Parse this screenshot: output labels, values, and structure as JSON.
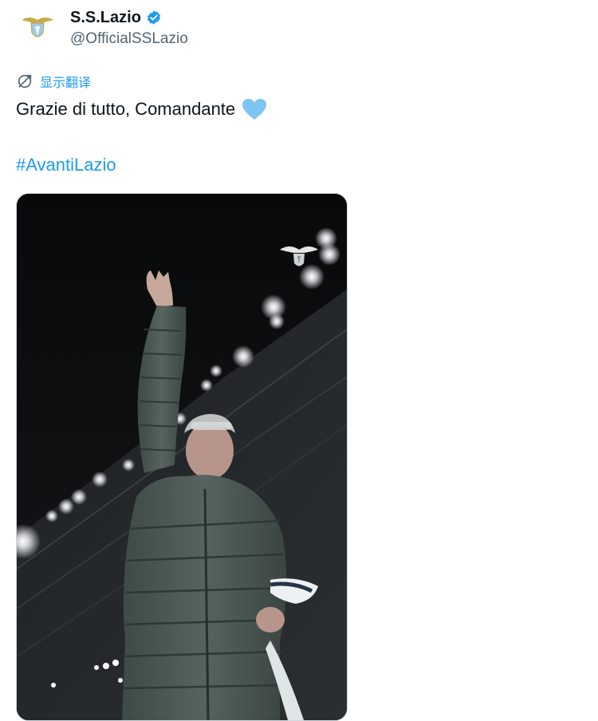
{
  "account": {
    "display_name": "S.S.Lazio",
    "handle": "@OfficialSSLazio",
    "verified": true,
    "avatar_icon": "lazio-eagle-logo-icon"
  },
  "translate": {
    "label": "显示翻译",
    "icon": "translate-icon"
  },
  "tweet": {
    "text": "Grazie di tutto, Comandante",
    "emoji": "light-blue-heart",
    "hashtag": "#AvantiLazio"
  },
  "media": {
    "type": "photo",
    "watermark_icon": "lazio-eagle-logo-icon"
  },
  "colors": {
    "accent": "#1d9bf0",
    "text_primary": "#0f1419",
    "text_secondary": "#536471",
    "heart": "#7cc4f2"
  }
}
